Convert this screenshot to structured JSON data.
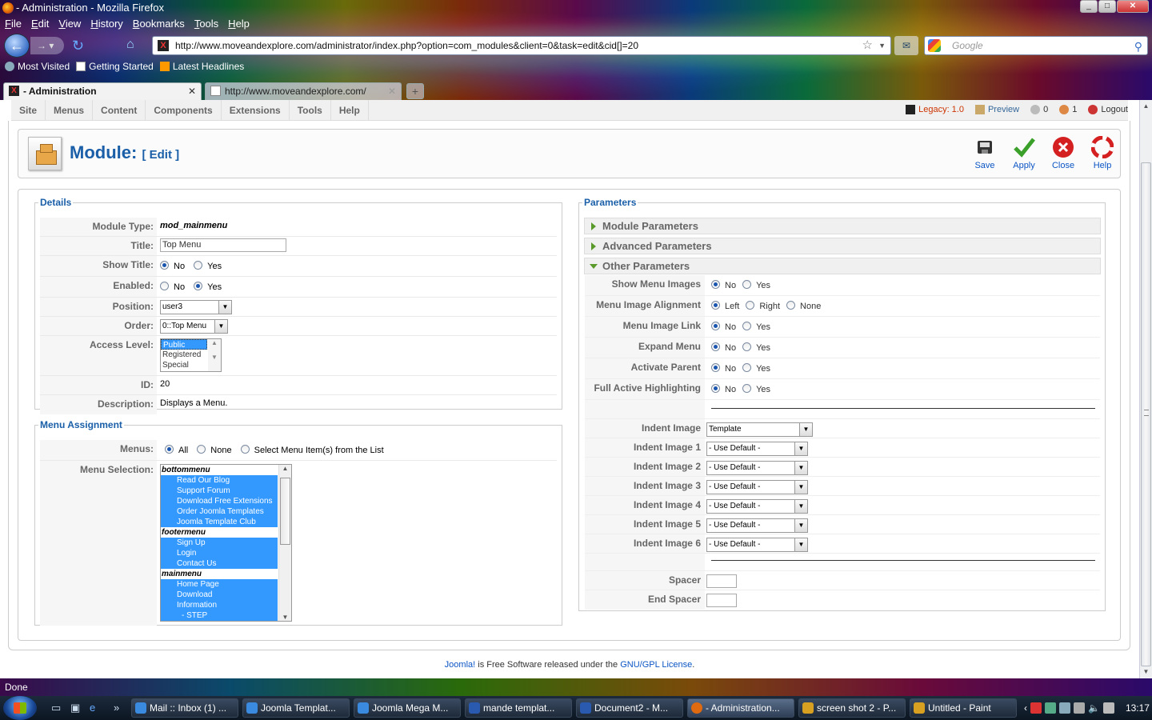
{
  "window": {
    "title": "- Administration - Mozilla Firefox",
    "buttons": [
      "_",
      "□",
      "✕"
    ]
  },
  "menubar": [
    "File",
    "Edit",
    "View",
    "History",
    "Bookmarks",
    "Tools",
    "Help"
  ],
  "nav": {
    "url": "http://www.moveandexplore.com/administrator/index.php?option=com_modules&client=0&task=edit&cid[]=20",
    "search_placeholder": "Google"
  },
  "bookmarks": [
    "Most Visited",
    "Getting Started",
    "Latest Headlines"
  ],
  "tabs": [
    {
      "label": "- Administration",
      "close": "✕"
    },
    {
      "label": "http://www.moveandexplore.com/",
      "close": "✕"
    }
  ],
  "newtab_label": "+",
  "admin_menu": [
    "Site",
    "Menus",
    "Content",
    "Components",
    "Extensions",
    "Tools",
    "Help"
  ],
  "admin_status": {
    "legacy": "Legacy: 1.0",
    "preview": "Preview",
    "messages": "0",
    "users": "1",
    "logout": "Logout"
  },
  "header": {
    "title": "Module:",
    "subtitle": "[ Edit ]"
  },
  "toolbar": {
    "save": "Save",
    "apply": "Apply",
    "close": "Close",
    "help": "Help"
  },
  "details": {
    "legend": "Details",
    "module_type_label": "Module Type:",
    "module_type": "mod_mainmenu",
    "title_label": "Title:",
    "title_value": "Top Menu",
    "show_title_label": "Show Title:",
    "enabled_label": "Enabled:",
    "no": "No",
    "yes": "Yes",
    "position_label": "Position:",
    "position_value": "user3",
    "order_label": "Order:",
    "order_value": "0::Top Menu",
    "access_label": "Access Level:",
    "access_options": [
      "Public",
      "Registered",
      "Special"
    ],
    "id_label": "ID:",
    "id_value": "20",
    "description_label": "Description:",
    "description_value": "Displays a Menu."
  },
  "menu_assignment": {
    "legend": "Menu Assignment",
    "menus_label": "Menus:",
    "all": "All",
    "none": "None",
    "select_list": "Select Menu Item(s) from the List",
    "menu_selection_label": "Menu Selection:",
    "groups": [
      {
        "name": "bottommenu",
        "items": [
          "Read Our Blog",
          "Support Forum",
          "Download Free Extensions",
          "Order Joomla Templates",
          "Joomla Template Club"
        ]
      },
      {
        "name": "footermenu",
        "items": [
          "Sign Up",
          "Login",
          "Contact Us"
        ]
      },
      {
        "name": "mainmenu",
        "items": [
          "Home Page",
          "Download",
          "Information",
          "- STEP"
        ]
      }
    ]
  },
  "parameters": {
    "legend": "Parameters",
    "module_params": "Module Parameters",
    "advanced_params": "Advanced Parameters",
    "other_params": "Other Parameters",
    "show_menu_images": "Show Menu Images",
    "menu_image_alignment": "Menu Image Alignment",
    "left": "Left",
    "right": "Right",
    "none": "None",
    "menu_image_link": "Menu Image Link",
    "expand_menu": "Expand Menu",
    "activate_parent": "Activate Parent",
    "full_active": "Full Active Highlighting",
    "indent_image": "Indent Image",
    "indent_image_value": "Template",
    "indent_image_1": "Indent Image 1",
    "indent_image_2": "Indent Image 2",
    "indent_image_3": "Indent Image 3",
    "indent_image_4": "Indent Image 4",
    "indent_image_5": "Indent Image 5",
    "indent_image_6": "Indent Image 6",
    "use_default": "- Use Default -",
    "spacer": "Spacer",
    "end_spacer": "End Spacer"
  },
  "footer": {
    "joomla": "Joomla!",
    "text": " is Free Software released under the ",
    "license": "GNU/GPL License",
    "dot": "."
  },
  "status": "Done",
  "taskbar": {
    "tasks": [
      "Mail :: Inbox (1) ...",
      "Joomla Templat...",
      "Joomla Mega M...",
      "mande templat...",
      "Document2 - M...",
      "- Administration...",
      "screen shot 2 - P...",
      "Untitled - Paint"
    ],
    "clock": "13:17"
  },
  "colors": {
    "accent_blue": "#1a5fa8",
    "selection_blue": "#3399ff",
    "legacy_red": "#cc3300",
    "apply_green": "#3aa02a",
    "close_red": "#d42020"
  }
}
